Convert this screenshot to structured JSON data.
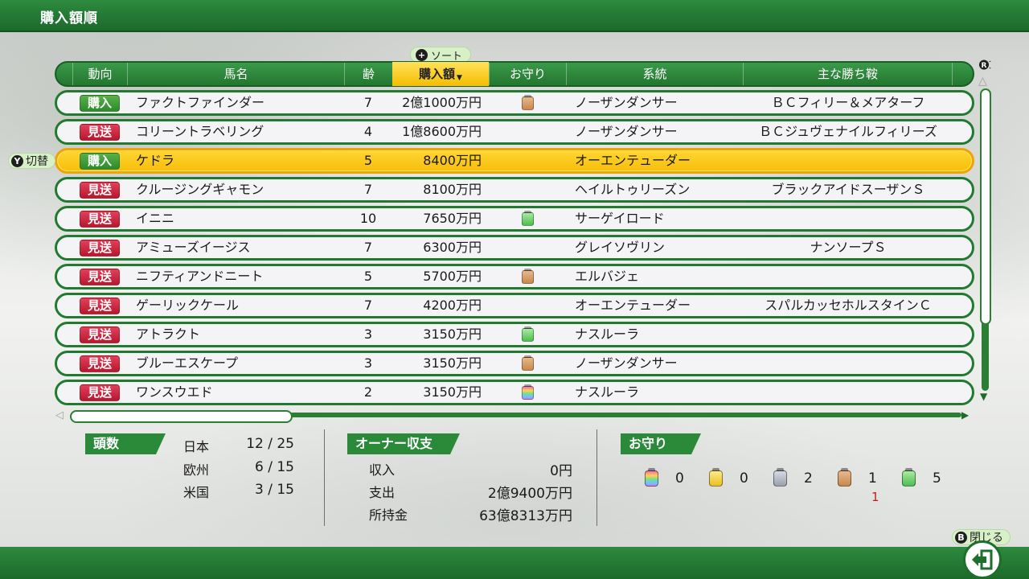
{
  "title": "購入額順",
  "sort_button": {
    "button": "+",
    "label": "ソート"
  },
  "switch_button": {
    "button": "Y",
    "label": "切替"
  },
  "close_button": {
    "button": "B",
    "label": "閉じる"
  },
  "scroll_r_button": "R",
  "columns": [
    "動向",
    "馬名",
    "齢",
    "購入額",
    "お守り",
    "系統",
    "主な勝ち鞍"
  ],
  "sorted_column": "購入額",
  "colors": {
    "green": "#2a8a3a",
    "buy": "#3a9a38",
    "skip": "#d0283f",
    "selected": "#ffd633",
    "charm_rainbow": "rainbow",
    "charm_yellow": "#f3d23c",
    "charm_gray": "#b7bcc8",
    "charm_brown": "#d8a46e",
    "charm_green": "#7fd67a"
  },
  "rows": [
    {
      "status": "購入",
      "status_type": "buy",
      "name": "ファクトファインダー",
      "age": "7",
      "price": "2億1000万円",
      "charm": "brown",
      "line": "ノーザンダンサー",
      "wins": "ＢＣフィリー＆メアターフ",
      "selected": false
    },
    {
      "status": "見送",
      "status_type": "skip",
      "name": "コリーントラベリング",
      "age": "4",
      "price": "1億8600万円",
      "charm": "",
      "line": "ノーザンダンサー",
      "wins": "ＢＣジュヴェナイルフィリーズ",
      "selected": false
    },
    {
      "status": "購入",
      "status_type": "buy",
      "name": "ケドラ",
      "age": "5",
      "price": "8400万円",
      "charm": "",
      "line": "オーエンテューダー",
      "wins": "",
      "selected": true
    },
    {
      "status": "見送",
      "status_type": "skip",
      "name": "クルージングギャモン",
      "age": "7",
      "price": "8100万円",
      "charm": "",
      "line": "ヘイルトゥリーズン",
      "wins": "ブラックアイドスーザンＳ",
      "selected": false
    },
    {
      "status": "見送",
      "status_type": "skip",
      "name": "イニニ",
      "age": "10",
      "price": "7650万円",
      "charm": "green",
      "line": "サーゲイロード",
      "wins": "",
      "selected": false
    },
    {
      "status": "見送",
      "status_type": "skip",
      "name": "アミューズイージス",
      "age": "7",
      "price": "6300万円",
      "charm": "",
      "line": "グレイソヴリン",
      "wins": "ナンソープＳ",
      "selected": false
    },
    {
      "status": "見送",
      "status_type": "skip",
      "name": "ニフティアンドニート",
      "age": "5",
      "price": "5700万円",
      "charm": "brown",
      "line": "エルバジェ",
      "wins": "",
      "selected": false
    },
    {
      "status": "見送",
      "status_type": "skip",
      "name": "ゲーリックケール",
      "age": "7",
      "price": "4200万円",
      "charm": "",
      "line": "オーエンテューダー",
      "wins": "スパルカッセホルスタインＣ",
      "selected": false
    },
    {
      "status": "見送",
      "status_type": "skip",
      "name": "アトラクト",
      "age": "3",
      "price": "3150万円",
      "charm": "green",
      "line": "ナスルーラ",
      "wins": "",
      "selected": false
    },
    {
      "status": "見送",
      "status_type": "skip",
      "name": "ブルーエスケープ",
      "age": "3",
      "price": "3150万円",
      "charm": "brown",
      "line": "ノーザンダンサー",
      "wins": "",
      "selected": false
    },
    {
      "status": "見送",
      "status_type": "skip",
      "name": "ワンスウエド",
      "age": "2",
      "price": "3150万円",
      "charm": "rainbow",
      "line": "ナスルーラ",
      "wins": "",
      "selected": false
    }
  ],
  "summary": {
    "heads": {
      "label": "頭数",
      "items": [
        {
          "label": "日本",
          "value": "12 / 25"
        },
        {
          "label": "欧州",
          "value": "6 / 15"
        },
        {
          "label": "米国",
          "value": "3 / 15"
        }
      ]
    },
    "owner": {
      "label": "オーナー収支",
      "items": [
        {
          "label": "収入",
          "value": "0円"
        },
        {
          "label": "支出",
          "value": "2億9400万円"
        },
        {
          "label": "所持金",
          "value": "63億8313万円"
        }
      ]
    },
    "charms": {
      "label": "お守り",
      "items": [
        {
          "icon": "rainbow-charm-icon",
          "color": "rainbow",
          "count": "0",
          "extra": ""
        },
        {
          "icon": "yellow-charm-icon",
          "color": "yellow",
          "count": "0",
          "extra": ""
        },
        {
          "icon": "gray-charm-icon",
          "color": "gray",
          "count": "2",
          "extra": ""
        },
        {
          "icon": "brown-charm-icon",
          "color": "brown",
          "count": "1",
          "extra": "1"
        },
        {
          "icon": "green-charm-icon",
          "color": "green",
          "count": "5",
          "extra": ""
        }
      ]
    }
  }
}
